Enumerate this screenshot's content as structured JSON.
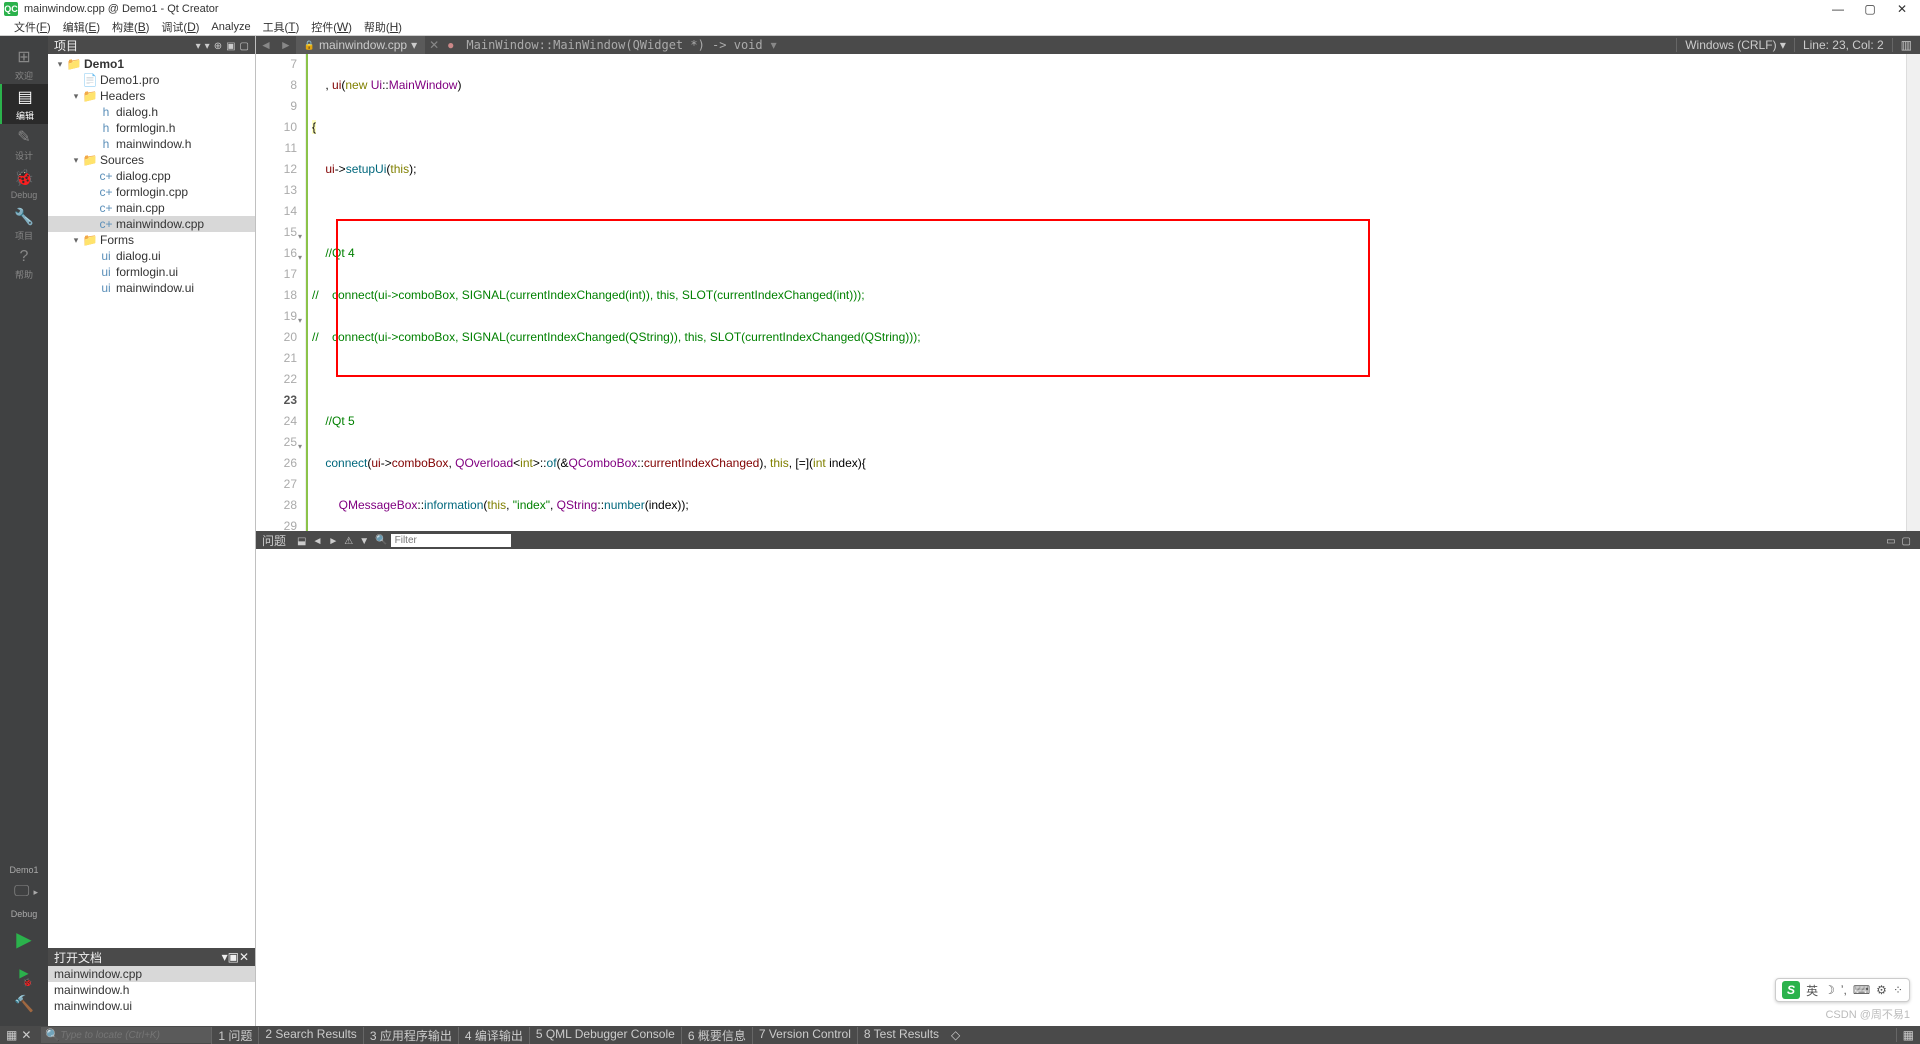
{
  "titlebar": {
    "app_icon_text": "QC",
    "title": "mainwindow.cpp @ Demo1 - Qt Creator",
    "win_min": "—",
    "win_max": "▢",
    "win_close": "✕"
  },
  "menubar": [
    {
      "label": "文件",
      "key": "F"
    },
    {
      "label": "编辑",
      "key": "E"
    },
    {
      "label": "构建",
      "key": "B"
    },
    {
      "label": "调试",
      "key": "D"
    },
    {
      "label": "Analyze",
      "key": ""
    },
    {
      "label": "工具",
      "key": "T"
    },
    {
      "label": "控件",
      "key": "W"
    },
    {
      "label": "帮助",
      "key": "H"
    }
  ],
  "activity": [
    {
      "icon": "⊞",
      "label": "欢迎"
    },
    {
      "icon": "▤",
      "label": "编辑",
      "active": true
    },
    {
      "icon": "✎",
      "label": "设计"
    },
    {
      "icon": "🐞",
      "label": "Debug"
    },
    {
      "icon": "🔧",
      "label": "项目"
    },
    {
      "icon": "?",
      "label": "帮助"
    }
  ],
  "activity_bottom": {
    "project": "Demo1",
    "kit_icon": "🖵",
    "kit_arrow": "▸",
    "config": "Debug",
    "run": "▶",
    "run_debug": "▶",
    "build": "🔨"
  },
  "side": {
    "header": "项目",
    "tools": [
      "▾",
      "▾",
      "⊕",
      "▣",
      "▢"
    ]
  },
  "tree": [
    {
      "indent": 0,
      "arrow": "▾",
      "icon": "📁",
      "name": "Demo1",
      "bold": true,
      "cls": "folder-icon"
    },
    {
      "indent": 1,
      "arrow": "",
      "icon": "📄",
      "name": "Demo1.pro",
      "cls": ""
    },
    {
      "indent": 1,
      "arrow": "▾",
      "icon": "📁",
      "name": "Headers",
      "cls": "folder-icon"
    },
    {
      "indent": 2,
      "arrow": "",
      "icon": "h",
      "name": "dialog.h",
      "cls": "hfile-icon"
    },
    {
      "indent": 2,
      "arrow": "",
      "icon": "h",
      "name": "formlogin.h",
      "cls": "hfile-icon"
    },
    {
      "indent": 2,
      "arrow": "",
      "icon": "h",
      "name": "mainwindow.h",
      "cls": "hfile-icon"
    },
    {
      "indent": 1,
      "arrow": "▾",
      "icon": "📁",
      "name": "Sources",
      "cls": "folder-icon"
    },
    {
      "indent": 2,
      "arrow": "",
      "icon": "c+",
      "name": "dialog.cpp",
      "cls": "cppfile-icon"
    },
    {
      "indent": 2,
      "arrow": "",
      "icon": "c+",
      "name": "formlogin.cpp",
      "cls": "cppfile-icon"
    },
    {
      "indent": 2,
      "arrow": "",
      "icon": "c+",
      "name": "main.cpp",
      "cls": "cppfile-icon"
    },
    {
      "indent": 2,
      "arrow": "",
      "icon": "c+",
      "name": "mainwindow.cpp",
      "cls": "cppfile-icon",
      "selected": true
    },
    {
      "indent": 1,
      "arrow": "▾",
      "icon": "📁",
      "name": "Forms",
      "cls": "folder-icon"
    },
    {
      "indent": 2,
      "arrow": "",
      "icon": "ui",
      "name": "dialog.ui",
      "cls": "uifile-icon"
    },
    {
      "indent": 2,
      "arrow": "",
      "icon": "ui",
      "name": "formlogin.ui",
      "cls": "uifile-icon"
    },
    {
      "indent": 2,
      "arrow": "",
      "icon": "ui",
      "name": "mainwindow.ui",
      "cls": "uifile-icon"
    }
  ],
  "open_docs": {
    "header": "打开文档",
    "tools": [
      "▾",
      "▣",
      "✕"
    ],
    "items": [
      "mainwindow.cpp",
      "mainwindow.h",
      "mainwindow.ui"
    ]
  },
  "editor_toolbar": {
    "back": "◄",
    "fwd": "►",
    "lock": "🔒",
    "file": "mainwindow.cpp",
    "file_arrow": "▾",
    "close": "✕",
    "fn_icon": "●",
    "breadcrumb": "MainWindow::MainWindow(QWidget *) -> void",
    "bc_arrow": "▾",
    "encoding": "Windows (CRLF)",
    "enc_arrow": "▾",
    "position": "Line: 23, Col: 2",
    "split": "▥"
  },
  "gutter_start": 7,
  "gutter_end": 29,
  "fold_lines": [
    15,
    16,
    19,
    25
  ],
  "current_line": 23,
  "issues": {
    "title": "问题",
    "tools": [
      "⬓",
      "◄",
      "►",
      "⚠",
      "▼"
    ],
    "filter_icon": "🔍",
    "filter_placeholder": "Filter",
    "right_tools": [
      "▭",
      "▢"
    ]
  },
  "statusbar": {
    "left_icons": [
      "▦",
      "✕"
    ],
    "search_icon": "🔍",
    "search_placeholder": "Type to locate (Ctrl+K)",
    "tabs": [
      "1 问题",
      "2 Search Results",
      "3 应用程序输出",
      "4 编译输出",
      "5 QML Debugger Console",
      "6 概要信息",
      "7 Version Control",
      "8 Test Results"
    ],
    "tabs_arrow": "◇",
    "right": "▦"
  },
  "watermark": "CSDN @周不易1",
  "ime": {
    "s": "S",
    "lang": "英",
    "moon": "☽",
    "comma": "ʼ,",
    "kb": "⌨",
    "gear": "⚙",
    "grid": "⁘"
  }
}
